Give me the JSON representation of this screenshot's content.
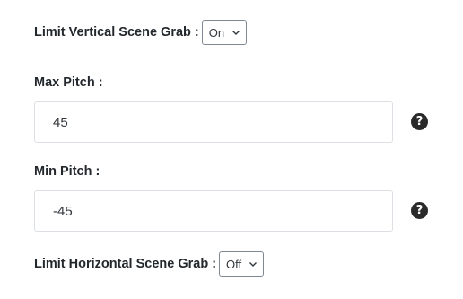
{
  "vertical_grab": {
    "label": "Limit Vertical Scene Grab :",
    "selected": "On"
  },
  "max_pitch": {
    "label": "Max Pitch :",
    "value": "45",
    "help_icon": "question-circle-icon"
  },
  "min_pitch": {
    "label": "Min Pitch :",
    "value": "-45",
    "help_icon": "question-circle-icon"
  },
  "horizontal_grab": {
    "label": "Limit Horizontal Scene Grab :",
    "selected": "Off"
  },
  "icons": {
    "help_glyph": "?"
  }
}
